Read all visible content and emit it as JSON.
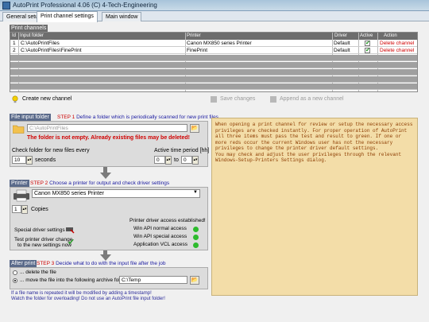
{
  "window": {
    "title": "AutoPrint Professional 4.06 (C) 4-Tech-Engineering"
  },
  "tabs": [
    "General setup",
    "Print channel settings",
    "Main window"
  ],
  "channels": {
    "group_label": "Print channels",
    "columns": [
      "Id",
      "Input folder",
      "Printer",
      "Driver",
      "Active",
      "Action"
    ],
    "rows": [
      {
        "id": "1",
        "folder": "C:\\AutoPrintFiles",
        "printer": "Canon MX850 series Printer",
        "driver": "Default",
        "active": true,
        "action": "Delete channel"
      },
      {
        "id": "2",
        "folder": "C:\\AutoPrintFiles\\FinePrint",
        "printer": "FinePrint",
        "driver": "Default",
        "active": true,
        "action": "Delete channel"
      }
    ],
    "create_label": "Create new channel",
    "save_label": "Save changes",
    "append_label": "Append as a new channel"
  },
  "step1": {
    "tag": "File input folder",
    "step": "STEP 1",
    "desc": "Define a folder which is periodically scanned for new print files",
    "folder": "C:\\AutoPrintFiles",
    "warning": "The folder is not empty. Already existing files may be deleted!",
    "check_label": "Check folder for new files every",
    "seconds_value": "10",
    "seconds_label": "seconds",
    "active_label": "Active time period [hh]",
    "from": "0",
    "to_label": "to",
    "to": "0"
  },
  "step2": {
    "tag": "Printer",
    "step": "STEP 2",
    "desc": "Choose a printer for output and check driver settings",
    "printer": "Canon MX850 series Printer",
    "copies_value": "1",
    "copies_label": "Copies",
    "access_established": "Printer driver access established!",
    "special_settings": "Special driver settings ...",
    "test_change_1": "Test printer driver change",
    "test_change_2": "to  the new settings now",
    "api_normal": "Win API normal access",
    "api_special": "Win API special access",
    "vcl_access": "Application VCL access",
    "status_color": "#2dbb2d"
  },
  "step3": {
    "tag": "After print",
    "step": "STEP 3",
    "desc": "Decide what to do with the input file after the job",
    "delete_label": "... delete the file",
    "move_label": "... move the file into the following archive folder",
    "archive_folder": "C:\\Temp",
    "note1": "If a file name is repeated it will be modified by adding a timestamp!",
    "note2": "Watch the folder for overloading! Do not use an AutoPrint file input folder!"
  },
  "info_text": "When opening a print channel for review or setup the necessary access privileges are checked instantly. For proper operation of AutoPrint all three items must pass the test and result to green. If one or more reds occur the current Windows user has not the necessary privileges to change the printer driver default settings.\nYou may check and adjust the user privileges through the relevant Windows-Setup-Printers Settings dialog."
}
